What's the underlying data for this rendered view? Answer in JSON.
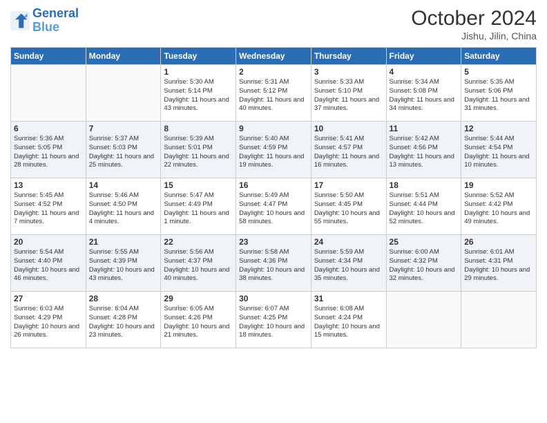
{
  "logo": {
    "line1": "General",
    "line2": "Blue"
  },
  "title": "October 2024",
  "location": "Jishu, Jilin, China",
  "days_of_week": [
    "Sunday",
    "Monday",
    "Tuesday",
    "Wednesday",
    "Thursday",
    "Friday",
    "Saturday"
  ],
  "weeks": [
    [
      {
        "day": "",
        "info": ""
      },
      {
        "day": "",
        "info": ""
      },
      {
        "day": "1",
        "info": "Sunrise: 5:30 AM\nSunset: 5:14 PM\nDaylight: 11 hours and 43 minutes."
      },
      {
        "day": "2",
        "info": "Sunrise: 5:31 AM\nSunset: 5:12 PM\nDaylight: 11 hours and 40 minutes."
      },
      {
        "day": "3",
        "info": "Sunrise: 5:33 AM\nSunset: 5:10 PM\nDaylight: 11 hours and 37 minutes."
      },
      {
        "day": "4",
        "info": "Sunrise: 5:34 AM\nSunset: 5:08 PM\nDaylight: 11 hours and 34 minutes."
      },
      {
        "day": "5",
        "info": "Sunrise: 5:35 AM\nSunset: 5:06 PM\nDaylight: 11 hours and 31 minutes."
      }
    ],
    [
      {
        "day": "6",
        "info": "Sunrise: 5:36 AM\nSunset: 5:05 PM\nDaylight: 11 hours and 28 minutes."
      },
      {
        "day": "7",
        "info": "Sunrise: 5:37 AM\nSunset: 5:03 PM\nDaylight: 11 hours and 25 minutes."
      },
      {
        "day": "8",
        "info": "Sunrise: 5:39 AM\nSunset: 5:01 PM\nDaylight: 11 hours and 22 minutes."
      },
      {
        "day": "9",
        "info": "Sunrise: 5:40 AM\nSunset: 4:59 PM\nDaylight: 11 hours and 19 minutes."
      },
      {
        "day": "10",
        "info": "Sunrise: 5:41 AM\nSunset: 4:57 PM\nDaylight: 11 hours and 16 minutes."
      },
      {
        "day": "11",
        "info": "Sunrise: 5:42 AM\nSunset: 4:56 PM\nDaylight: 11 hours and 13 minutes."
      },
      {
        "day": "12",
        "info": "Sunrise: 5:44 AM\nSunset: 4:54 PM\nDaylight: 11 hours and 10 minutes."
      }
    ],
    [
      {
        "day": "13",
        "info": "Sunrise: 5:45 AM\nSunset: 4:52 PM\nDaylight: 11 hours and 7 minutes."
      },
      {
        "day": "14",
        "info": "Sunrise: 5:46 AM\nSunset: 4:50 PM\nDaylight: 11 hours and 4 minutes."
      },
      {
        "day": "15",
        "info": "Sunrise: 5:47 AM\nSunset: 4:49 PM\nDaylight: 11 hours and 1 minute."
      },
      {
        "day": "16",
        "info": "Sunrise: 5:49 AM\nSunset: 4:47 PM\nDaylight: 10 hours and 58 minutes."
      },
      {
        "day": "17",
        "info": "Sunrise: 5:50 AM\nSunset: 4:45 PM\nDaylight: 10 hours and 55 minutes."
      },
      {
        "day": "18",
        "info": "Sunrise: 5:51 AM\nSunset: 4:44 PM\nDaylight: 10 hours and 52 minutes."
      },
      {
        "day": "19",
        "info": "Sunrise: 5:52 AM\nSunset: 4:42 PM\nDaylight: 10 hours and 49 minutes."
      }
    ],
    [
      {
        "day": "20",
        "info": "Sunrise: 5:54 AM\nSunset: 4:40 PM\nDaylight: 10 hours and 46 minutes."
      },
      {
        "day": "21",
        "info": "Sunrise: 5:55 AM\nSunset: 4:39 PM\nDaylight: 10 hours and 43 minutes."
      },
      {
        "day": "22",
        "info": "Sunrise: 5:56 AM\nSunset: 4:37 PM\nDaylight: 10 hours and 40 minutes."
      },
      {
        "day": "23",
        "info": "Sunrise: 5:58 AM\nSunset: 4:36 PM\nDaylight: 10 hours and 38 minutes."
      },
      {
        "day": "24",
        "info": "Sunrise: 5:59 AM\nSunset: 4:34 PM\nDaylight: 10 hours and 35 minutes."
      },
      {
        "day": "25",
        "info": "Sunrise: 6:00 AM\nSunset: 4:32 PM\nDaylight: 10 hours and 32 minutes."
      },
      {
        "day": "26",
        "info": "Sunrise: 6:01 AM\nSunset: 4:31 PM\nDaylight: 10 hours and 29 minutes."
      }
    ],
    [
      {
        "day": "27",
        "info": "Sunrise: 6:03 AM\nSunset: 4:29 PM\nDaylight: 10 hours and 26 minutes."
      },
      {
        "day": "28",
        "info": "Sunrise: 6:04 AM\nSunset: 4:28 PM\nDaylight: 10 hours and 23 minutes."
      },
      {
        "day": "29",
        "info": "Sunrise: 6:05 AM\nSunset: 4:26 PM\nDaylight: 10 hours and 21 minutes."
      },
      {
        "day": "30",
        "info": "Sunrise: 6:07 AM\nSunset: 4:25 PM\nDaylight: 10 hours and 18 minutes."
      },
      {
        "day": "31",
        "info": "Sunrise: 6:08 AM\nSunset: 4:24 PM\nDaylight: 10 hours and 15 minutes."
      },
      {
        "day": "",
        "info": ""
      },
      {
        "day": "",
        "info": ""
      }
    ]
  ]
}
